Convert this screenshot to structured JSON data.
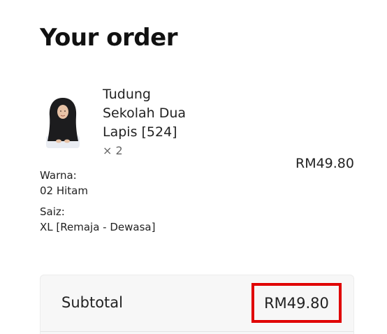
{
  "order": {
    "title": "Your order",
    "item": {
      "name": "Tudung Sekolah Dua Lapis [524]",
      "quantity": "× 2",
      "price": "RM49.80",
      "image_icon": "product-thumbnail",
      "attributes": [
        {
          "label": "Warna:",
          "value": "02 Hitam"
        },
        {
          "label": "Saiz:",
          "value": "XL [Remaja - Dewasa]"
        }
      ]
    },
    "summary": {
      "subtotal_label": "Subtotal",
      "subtotal_value": "RM49.80"
    }
  },
  "colors": {
    "highlight": "#e00000",
    "summary_bg": "#f7f7f7"
  }
}
